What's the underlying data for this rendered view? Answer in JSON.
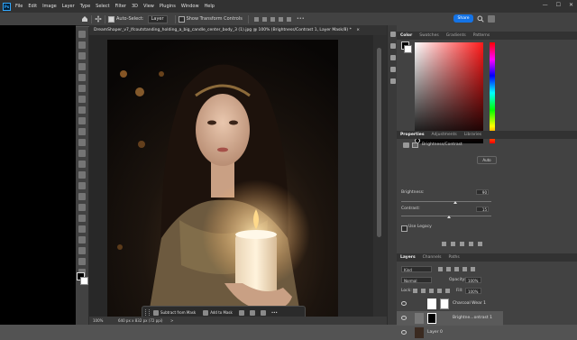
{
  "app": {
    "logo": "Ps"
  },
  "menu": [
    "File",
    "Edit",
    "Image",
    "Layer",
    "Type",
    "Select",
    "Filter",
    "3D",
    "View",
    "Plugins",
    "Window",
    "Help"
  ],
  "window_controls": {
    "minimize": "—",
    "maximize": "☐",
    "close": "✕"
  },
  "options_bar": {
    "auto_select_label": "Auto-Select:",
    "auto_select_value": "Layer",
    "show_transform_label": "Show Transform Controls",
    "more": "•••",
    "share_label": "Share"
  },
  "document": {
    "tab_title": "DreamShaper_v7_Ifcoutstanding_holding_a_big_candle_center_body_3 (1).jpg @ 100% (Brightness/Contrast 1, Layer Mask/8) *",
    "tab_close": "×",
    "zoom": "100%",
    "dimensions": "640 px x 832 px (72 ppi)",
    "status_arrow": ">"
  },
  "taskbar": {
    "subtract_label": "Subtract from Mask",
    "add_label": "Add to Mask",
    "more": "•••"
  },
  "color_panel": {
    "tabs": [
      "Color",
      "Swatches",
      "Gradients",
      "Patterns"
    ],
    "active_tab": "Color",
    "hue_color": "#ff1a1a"
  },
  "properties_panel": {
    "tabs": [
      "Properties",
      "Adjustments",
      "Libraries"
    ],
    "adjustment_name": "Brightness/Contrast",
    "auto_label": "Auto",
    "brightness_label": "Brightness:",
    "brightness_value": "90",
    "brightness_fraction": 0.6,
    "contrast_label": "Contrast:",
    "contrast_value": "15",
    "contrast_fraction": 0.53,
    "use_legacy_label": "Use Legacy"
  },
  "layers_panel": {
    "tabs": [
      "Layers",
      "Channels",
      "Paths"
    ],
    "kind_label": "Kind",
    "blend_mode": "Normal",
    "opacity_label": "Opacity:",
    "opacity_value": "100%",
    "lock_label": "Lock:",
    "fill_label": "Fill:",
    "fill_value": "100%",
    "layers": [
      {
        "name": "Charcoal Wear 1"
      },
      {
        "name": "Brightne...ontrast 1"
      },
      {
        "name": "Layer 0"
      }
    ]
  },
  "accent_color": "#1473e6"
}
